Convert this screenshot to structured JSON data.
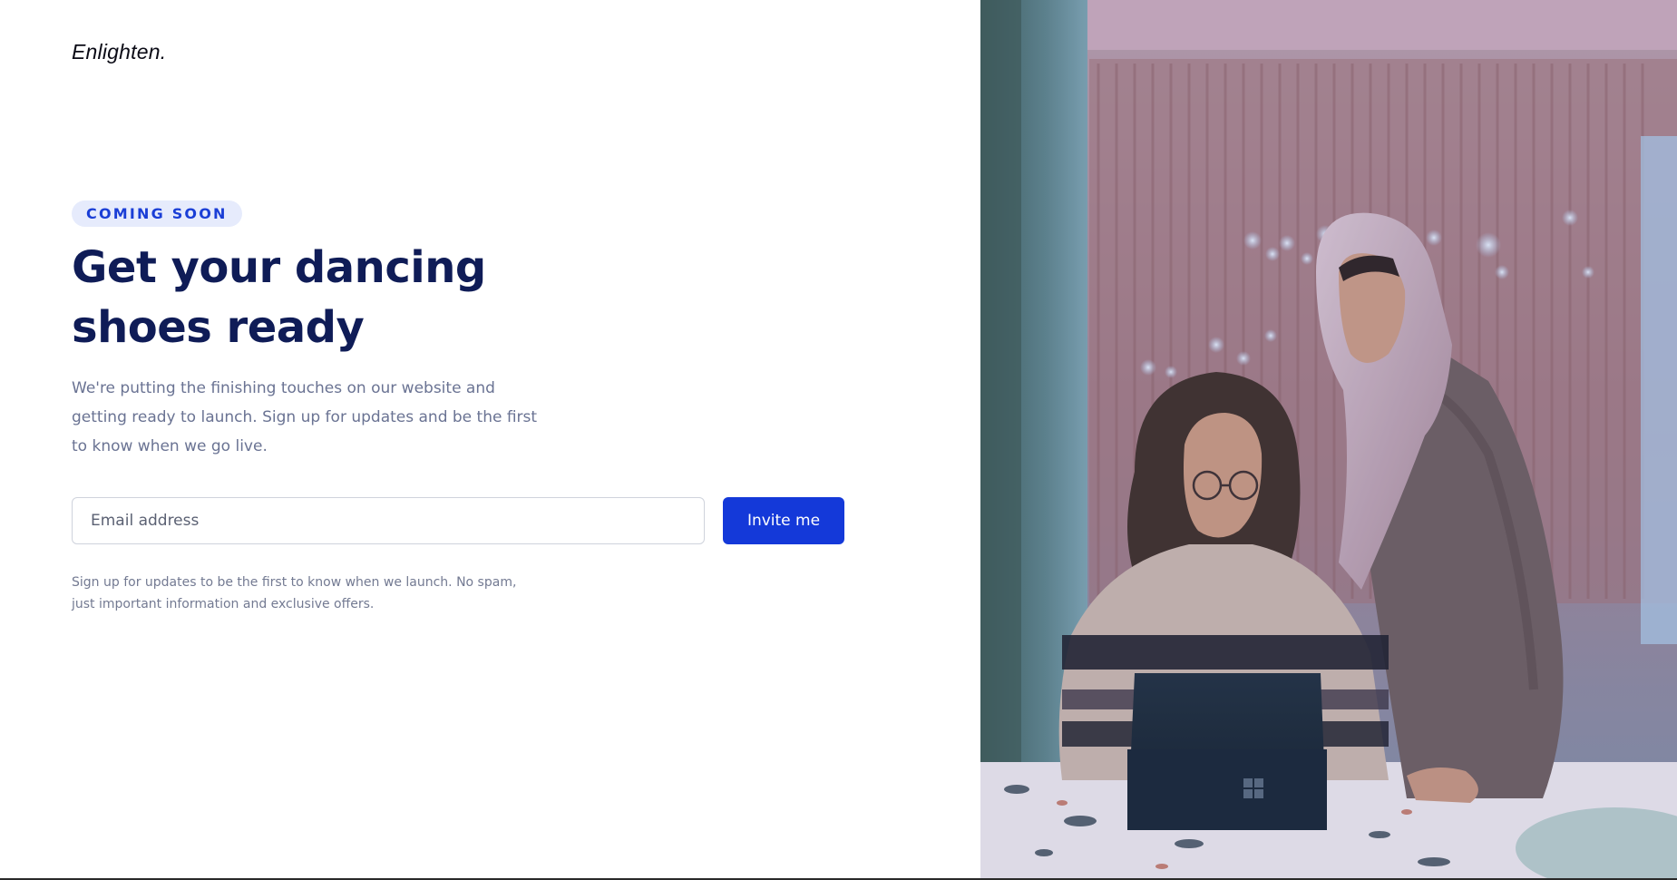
{
  "brand": {
    "logo_text": "Enlighten."
  },
  "hero": {
    "badge": "COMING SOON",
    "headline": "Get your dancing shoes ready",
    "description": "We're putting the finishing touches on our website and getting ready to launch. Sign up for updates and be the first to know when we go live."
  },
  "signup": {
    "email_placeholder": "Email address",
    "email_value": "",
    "submit_label": "Invite me",
    "note": "Sign up for updates to be the first to know when we launch. No spam, just important information and exclusive offers."
  },
  "colors": {
    "accent": "#1439d9",
    "heading": "#0f1c57",
    "badge_bg": "#e6ebfc",
    "badge_text": "#1a3ed6",
    "body_text": "#6a7393"
  },
  "image": {
    "subject": "two-women-with-laptop-photo"
  }
}
